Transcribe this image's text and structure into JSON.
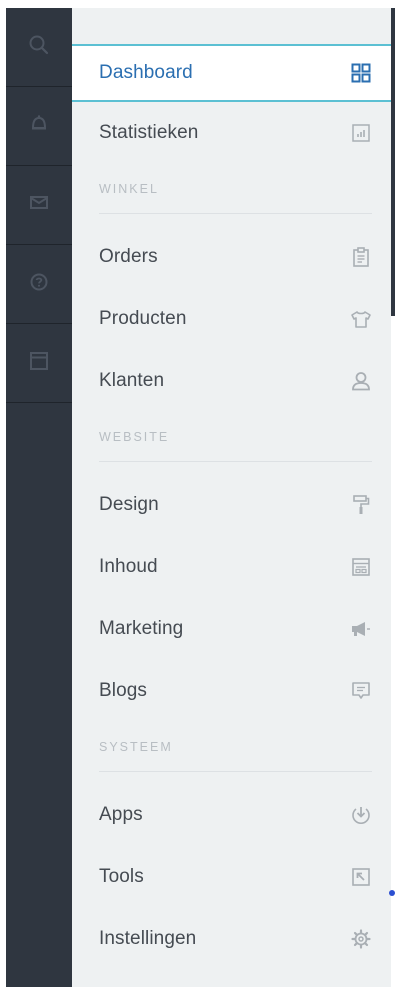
{
  "rail": {
    "items": [
      {
        "icon": "search-icon"
      },
      {
        "icon": "bell-icon"
      },
      {
        "icon": "mail-icon"
      },
      {
        "icon": "help-icon"
      },
      {
        "icon": "window-icon"
      }
    ]
  },
  "nav": {
    "dashboard": {
      "label": "Dashboard",
      "icon": "grid-icon"
    },
    "statistieken": {
      "label": "Statistieken",
      "icon": "chart-icon"
    },
    "sections": {
      "winkel": "WINKEL",
      "website": "WEBSITE",
      "systeem": "SYSTEEM"
    },
    "orders": {
      "label": "Orders",
      "icon": "clipboard-icon"
    },
    "producten": {
      "label": "Producten",
      "icon": "tshirt-icon"
    },
    "klanten": {
      "label": "Klanten",
      "icon": "user-icon"
    },
    "design": {
      "label": "Design",
      "icon": "paint-roller-icon"
    },
    "inhoud": {
      "label": "Inhoud",
      "icon": "layout-icon"
    },
    "marketing": {
      "label": "Marketing",
      "icon": "megaphone-icon"
    },
    "blogs": {
      "label": "Blogs",
      "icon": "comment-icon"
    },
    "apps": {
      "label": "Apps",
      "icon": "download-icon"
    },
    "tools": {
      "label": "Tools",
      "icon": "external-icon"
    },
    "instellingen": {
      "label": "Instellingen",
      "icon": "gear-icon"
    }
  },
  "colors": {
    "rail_bg": "#2f3640",
    "panel_bg": "#eef1f2",
    "active_text": "#2b6fb1",
    "active_border": "#5bc0d3",
    "icon_gray": "#a9afb4"
  }
}
